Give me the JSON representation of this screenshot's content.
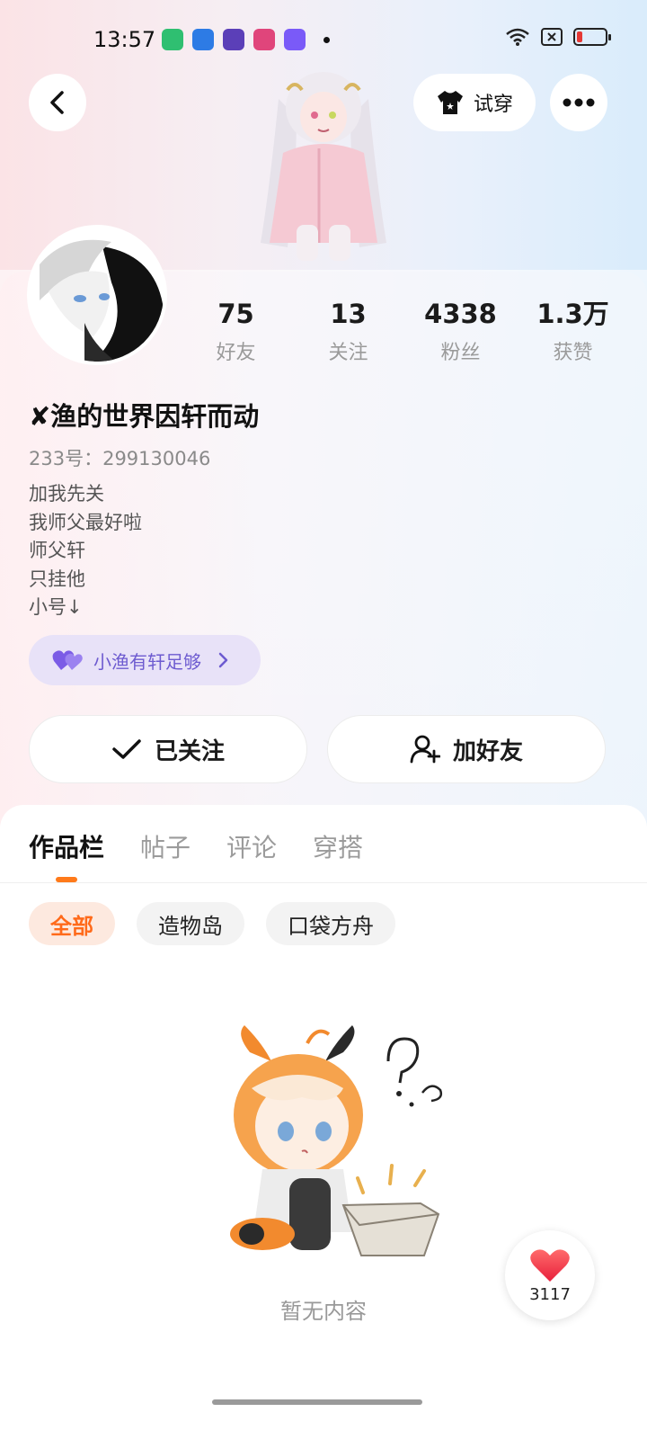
{
  "status_bar": {
    "time": "13:57",
    "app_icon_colors": [
      "#2fbf71",
      "#2d7be5",
      "#5b3fb8",
      "#e0457b",
      "#7a5af8"
    ]
  },
  "header": {
    "back_icon": "chevron-left-icon",
    "try_on_label": "试穿",
    "try_on_icon": "tshirt-icon",
    "more_icon": "more-dots-icon"
  },
  "profile": {
    "nickname": "✘渔的世界因轩而动",
    "uid": "233号：299130046",
    "bio": [
      "加我先关",
      "我师父最好啦",
      "师父轩",
      "只挂他",
      "小号↓"
    ],
    "stats": [
      {
        "value": "75",
        "label": "好友"
      },
      {
        "value": "13",
        "label": "关注"
      },
      {
        "value": "4338",
        "label": "粉丝"
      },
      {
        "value": "1.3万",
        "label": "获赞"
      }
    ],
    "relationship_tag": "小渔有轩足够"
  },
  "actions": {
    "followed_label": "已关注",
    "add_friend_label": "加好友"
  },
  "tabs": [
    "作品栏",
    "帖子",
    "评论",
    "穿搭"
  ],
  "active_tab": 0,
  "filters": [
    "全部",
    "造物岛",
    "口袋方舟"
  ],
  "active_filter": 0,
  "empty_state": {
    "text": "暂无内容"
  },
  "like_fab": {
    "count": "3117"
  },
  "colors": {
    "accent": "#ff7a1a",
    "tag_purple": "#6d5bd0",
    "heart_red": "#f0304a"
  }
}
